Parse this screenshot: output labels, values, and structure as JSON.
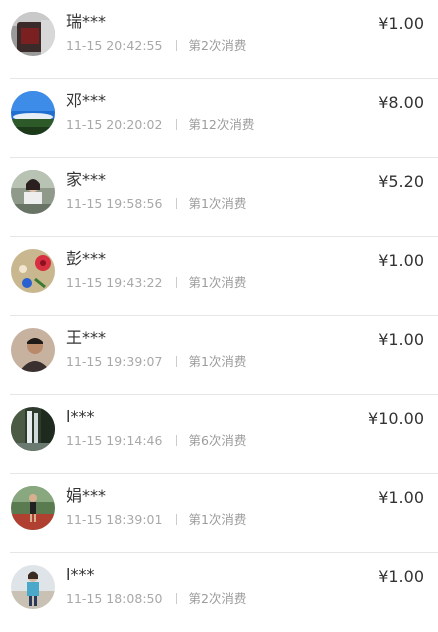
{
  "records": [
    {
      "name": "瑞***",
      "time": "11-15 20:42:55",
      "count": "第2次消费",
      "amount": "¥1.00",
      "avatar_icon": "photo-dark-red-avatar-icon"
    },
    {
      "name": "邓***",
      "time": "11-15 20:20:02",
      "count": "第12次消费",
      "amount": "¥8.00",
      "avatar_icon": "sky-landscape-avatar-icon"
    },
    {
      "name": "家***",
      "time": "11-15 19:58:56",
      "count": "第1次消费",
      "amount": "¥5.20",
      "avatar_icon": "girl-photo-avatar-icon"
    },
    {
      "name": "彭***",
      "time": "11-15 19:43:22",
      "count": "第1次消费",
      "amount": "¥1.00",
      "avatar_icon": "flower-avatar-icon"
    },
    {
      "name": "王***",
      "time": "11-15 19:39:07",
      "count": "第1次消费",
      "amount": "¥1.00",
      "avatar_icon": "man-portrait-avatar-icon"
    },
    {
      "name": "l***",
      "time": "11-15 19:14:46",
      "count": "第6次消费",
      "amount": "¥10.00",
      "avatar_icon": "waterfall-avatar-icon"
    },
    {
      "name": "娟***",
      "time": "11-15 18:39:01",
      "count": "第1次消费",
      "amount": "¥1.00",
      "avatar_icon": "runner-track-avatar-icon"
    },
    {
      "name": "l***",
      "time": "11-15 18:08:50",
      "count": "第2次消费",
      "amount": "¥1.00",
      "avatar_icon": "woman-outdoor-avatar-icon"
    }
  ],
  "colors": {
    "text_primary": "#333333",
    "text_secondary": "#a8a8a8",
    "divider": "#e6e6e6",
    "background": "#ffffff"
  }
}
